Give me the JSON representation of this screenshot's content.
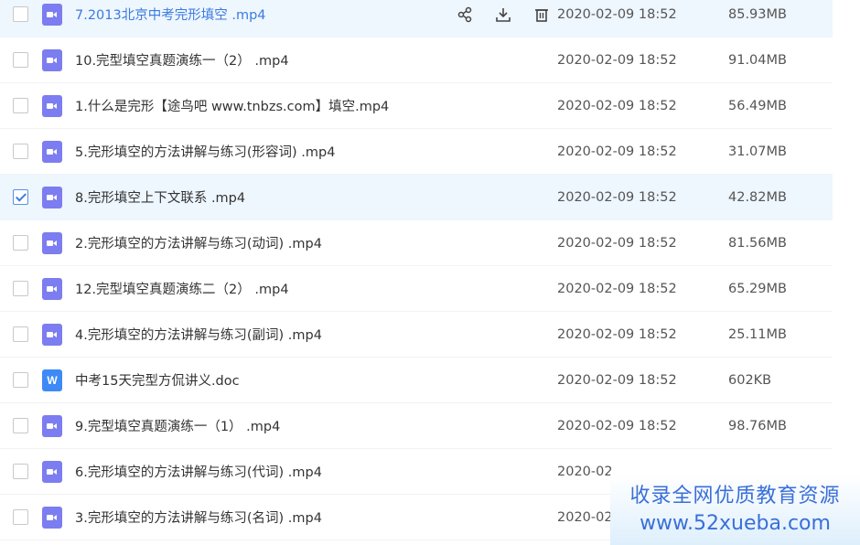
{
  "files": [
    {
      "name": "7.2013北京中考完形填空  .mp4",
      "date": "2020-02-09 18:52",
      "size": "85.93MB",
      "type": "video",
      "checked": false,
      "hover": true
    },
    {
      "name": "10.完型填空真题演练一（2）  .mp4",
      "date": "2020-02-09 18:52",
      "size": "91.04MB",
      "type": "video",
      "checked": false
    },
    {
      "name": "1.什么是完形【途鸟吧 www.tnbzs.com】填空.mp4",
      "date": "2020-02-09 18:52",
      "size": "56.49MB",
      "type": "video",
      "checked": false
    },
    {
      "name": "5.完形填空的方法讲解与练习(形容词)  .mp4",
      "date": "2020-02-09 18:52",
      "size": "31.07MB",
      "type": "video",
      "checked": false
    },
    {
      "name": "8.完形填空上下文联系  .mp4",
      "date": "2020-02-09 18:52",
      "size": "42.82MB",
      "type": "video",
      "checked": true
    },
    {
      "name": "2.完形填空的方法讲解与练习(动词)  .mp4",
      "date": "2020-02-09 18:52",
      "size": "81.56MB",
      "type": "video",
      "checked": false
    },
    {
      "name": "12.完型填空真题演练二（2）  .mp4",
      "date": "2020-02-09 18:52",
      "size": "65.29MB",
      "type": "video",
      "checked": false
    },
    {
      "name": "4.完形填空的方法讲解与练习(副词)  .mp4",
      "date": "2020-02-09 18:52",
      "size": "25.11MB",
      "type": "video",
      "checked": false
    },
    {
      "name": "中考15天完型方侃讲义.doc",
      "date": "2020-02-09 18:52",
      "size": "602KB",
      "type": "doc",
      "checked": false
    },
    {
      "name": "9.完型填空真题演练一（1）  .mp4",
      "date": "2020-02-09 18:52",
      "size": "98.76MB",
      "type": "video",
      "checked": false
    },
    {
      "name": "6.完形填空的方法讲解与练习(代词)  .mp4",
      "date": "2020-02",
      "size": "",
      "type": "video",
      "checked": false
    },
    {
      "name": "3.完形填空的方法讲解与练习(名词)  .mp4",
      "date": "2020-02",
      "size": "",
      "type": "video",
      "checked": false
    }
  ],
  "doc_icon_letter": "W",
  "action_icons": [
    "share-icon",
    "download-icon",
    "delete-icon"
  ],
  "watermark": {
    "line1": "收录全网优质教育资源",
    "line2": "www.52xueba.com"
  },
  "colors": {
    "hover_bg": "#eef6fe",
    "accent": "#3b7be0",
    "video_icon": "#7c7df0",
    "doc_icon": "#3d8af7"
  }
}
